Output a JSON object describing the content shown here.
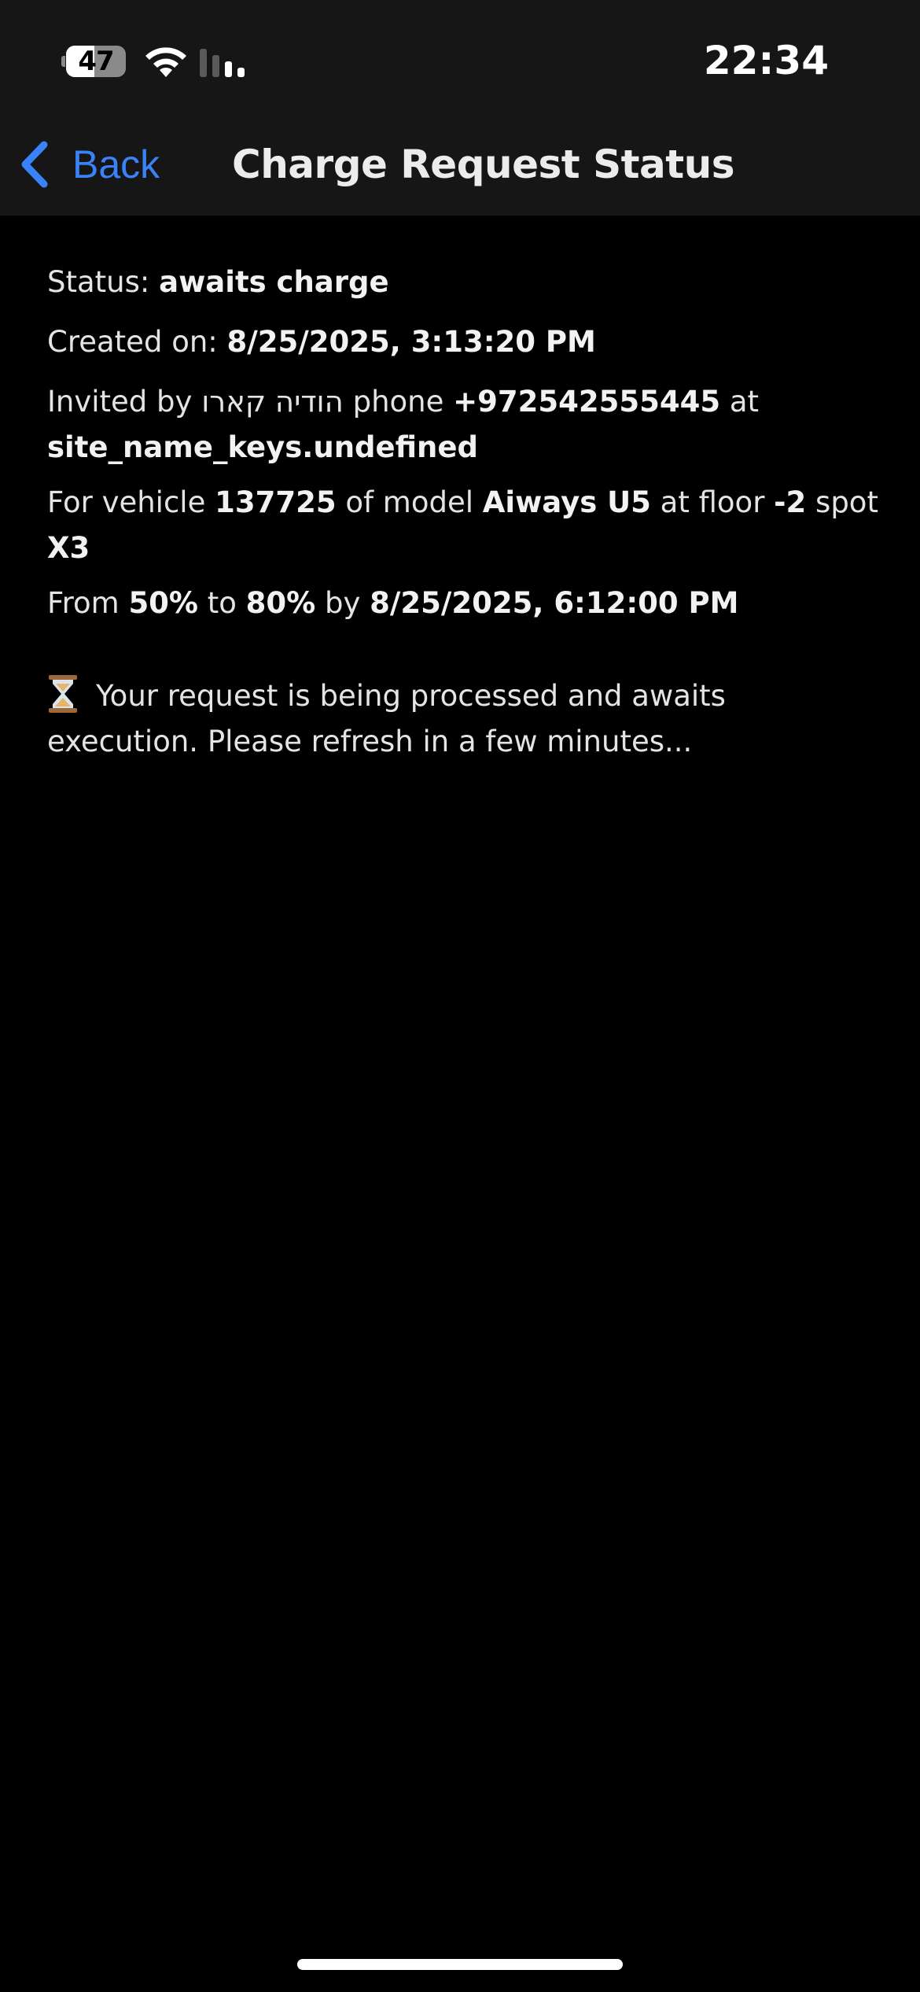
{
  "status_bar": {
    "battery_level": "47",
    "battery_fraction": 0.47,
    "time": "22:34"
  },
  "nav": {
    "back_label": "Back",
    "title": "Charge Request Status"
  },
  "details": {
    "status_prefix": "Status: ",
    "status_value": "awaits charge",
    "created_prefix": "Created on: ",
    "created_value": "8/25/2025, 3:13:20 PM",
    "invited_prefix": "Invited by ",
    "invited_name": "הודיה קארו",
    "invited_phone_prefix": " phone ",
    "invited_phone": "+972542555445",
    "invited_at": " at ",
    "site_name": "site_name_keys.undefined",
    "vehicle_prefix": "For vehicle ",
    "vehicle_id": "137725",
    "model_prefix": " of model ",
    "model": "Aiways U5",
    "floor_prefix": " at floor ",
    "floor": "-2",
    "spot_prefix": " spot ",
    "spot": "X3",
    "from_prefix": "From ",
    "from_pct": "50%",
    "to_prefix": " to ",
    "to_pct": "80%",
    "by_prefix": " by ",
    "by_value": "8/25/2025, 6:12:00 PM"
  },
  "message": {
    "icon": "hourglass-icon",
    "text": "Your request is being processed and awaits execution. Please refresh in a few minutes..."
  },
  "colors": {
    "accent": "#3a82f7",
    "background": "#000000",
    "header_background": "#161616"
  }
}
